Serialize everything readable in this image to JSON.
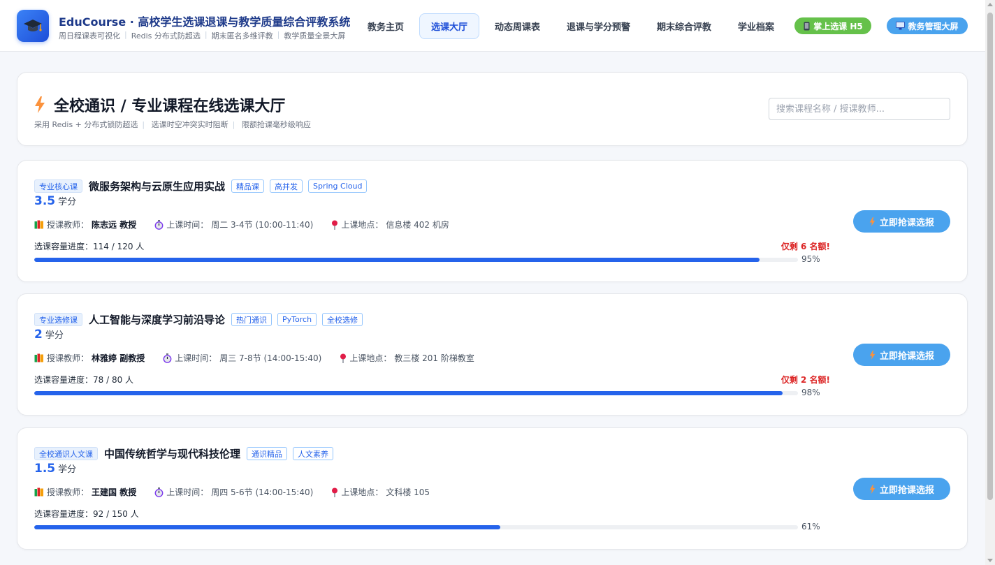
{
  "header": {
    "title": "EduCourse · 高校学生选课退课与教学质量综合评教系统",
    "features": [
      "周日程课表可视化",
      "Redis 分布式防超选",
      "期末匿名多维评教",
      "教学质量全景大屏"
    ],
    "nav": [
      "教务主页",
      "选课大厅",
      "动态周课表",
      "退课与学分预警",
      "期末综合评教",
      "学业档案"
    ],
    "active_nav": "选课大厅",
    "mobile_btn": "掌上选课 H5",
    "admin_btn": "教务管理大屏"
  },
  "hall": {
    "title": "全校通识 / 专业课程在线选课大厅",
    "features": [
      "采用 Redis + 分布式锁防超选",
      "选课时空冲突实时阻断",
      "限额抢课毫秒级响应"
    ],
    "search_placeholder": "搜索课程名称 / 授课教师..."
  },
  "labels": {
    "credit_unit": "学分",
    "teacher": "授课教师：",
    "time": "上课时间：",
    "location": "上课地点：",
    "capacity": "选课容量进度：",
    "grab_button": "立即抢课选报"
  },
  "courses": [
    {
      "type": "专业核心课",
      "name": "微服务架构与云原生应用实战",
      "tags": [
        "精品课",
        "高并发",
        "Spring Cloud"
      ],
      "credit": "3.5",
      "teacher": "陈志远 教授",
      "time": "周二 3-4节 (10:00-11:40)",
      "location": "信息楼 402 机房",
      "capacity": "114 / 120 人",
      "remain": "仅剩 6 名额!",
      "percent": 95,
      "percent_text": "95%"
    },
    {
      "type": "专业选修课",
      "name": "人工智能与深度学习前沿导论",
      "tags": [
        "热门通识",
        "PyTorch",
        "全校选修"
      ],
      "credit": "2",
      "teacher": "林雅婷 副教授",
      "time": "周三 7-8节 (14:00-15:40)",
      "location": "教三楼 201 阶梯教室",
      "capacity": "78 / 80 人",
      "remain": "仅剩 2 名额!",
      "percent": 98,
      "percent_text": "98%"
    },
    {
      "type": "全校通识人文课",
      "name": "中国传统哲学与现代科技伦理",
      "tags": [
        "通识精品",
        "人文素养"
      ],
      "credit": "1.5",
      "teacher": "王建国 教授",
      "time": "周四 5-6节 (14:00-15:40)",
      "location": "文科楼 105",
      "capacity": "92 / 150 人",
      "remain": "",
      "percent": 61,
      "percent_text": "61%"
    }
  ],
  "colors": {
    "accent": "#2563eb",
    "warning": "#dc2626",
    "button": "#4aa3ee",
    "mobile": "#65c14a"
  },
  "icons": {
    "logo": "graduation-cap-icon",
    "hall": "lightning-icon",
    "teacher": "books-icon",
    "time": "stopwatch-icon",
    "location": "pin-icon",
    "mobile": "phone-icon",
    "admin": "monitor-icon"
  }
}
